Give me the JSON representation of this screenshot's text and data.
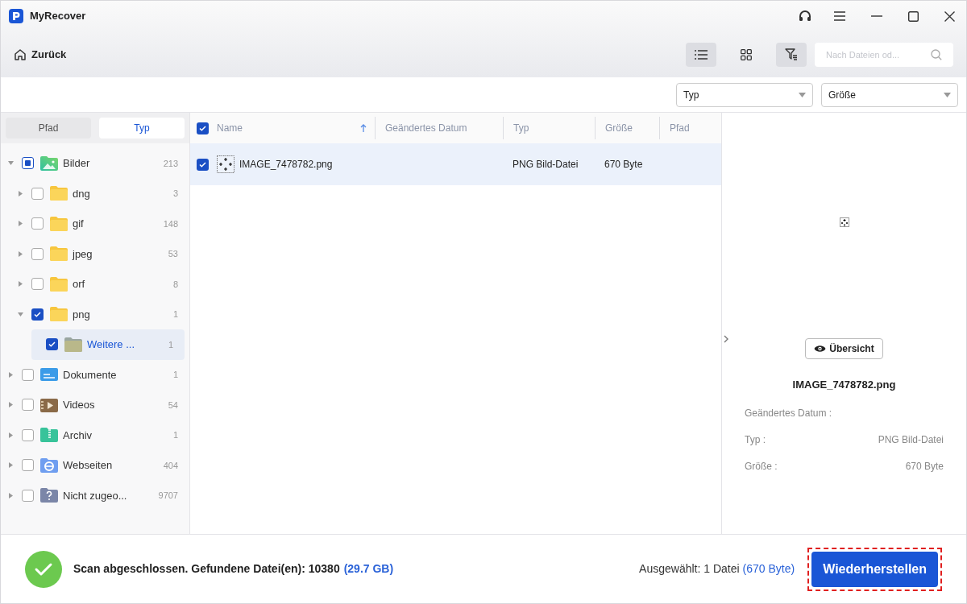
{
  "window": {
    "title": "MyRecover"
  },
  "toolbar": {
    "back": "Zurück",
    "views": [
      {
        "kind": "list",
        "selected": true
      },
      {
        "kind": "grid",
        "selected": false
      },
      {
        "kind": "filter",
        "selected": true
      }
    ],
    "search": {
      "placeholder": "Nach Dateien od..."
    }
  },
  "filters": [
    {
      "label": "Typ"
    },
    {
      "label": "Größe"
    }
  ],
  "sidebar": {
    "tabs": [
      {
        "label": "Pfad",
        "selected": false
      },
      {
        "label": "Typ",
        "selected": true
      }
    ],
    "items": [
      {
        "label": "Bilder",
        "count": "213",
        "kind": "images",
        "checked": false,
        "partial": true,
        "expanded": true,
        "selected": false,
        "children": [
          {
            "label": "dng",
            "count": "3",
            "kind": "folder",
            "checked": false,
            "expanded": false,
            "selected": false
          },
          {
            "label": "gif",
            "count": "148",
            "kind": "folder",
            "checked": false,
            "expanded": false,
            "selected": false
          },
          {
            "label": "jpeg",
            "count": "53",
            "kind": "folder",
            "checked": false,
            "expanded": false,
            "selected": false
          },
          {
            "label": "orf",
            "count": "8",
            "kind": "folder",
            "checked": false,
            "expanded": false,
            "selected": false
          },
          {
            "label": "png",
            "count": "1",
            "kind": "folder",
            "checked": true,
            "expanded": true,
            "selected": false,
            "children": [
              {
                "label": "Weitere ...",
                "count": "1",
                "kind": "subfolder",
                "checked": true,
                "selected": true
              }
            ]
          }
        ]
      },
      {
        "label": "Dokumente",
        "count": "1",
        "kind": "documents",
        "checked": false,
        "expanded": false,
        "selected": false
      },
      {
        "label": "Videos",
        "count": "54",
        "kind": "videos",
        "checked": false,
        "expanded": false,
        "selected": false
      },
      {
        "label": "Archiv",
        "count": "1",
        "kind": "archive",
        "checked": false,
        "expanded": false,
        "selected": false
      },
      {
        "label": "Webseiten",
        "count": "404",
        "kind": "web",
        "checked": false,
        "expanded": false,
        "selected": false
      },
      {
        "label": "Nicht zugeo...",
        "count": "9707",
        "kind": "unknown",
        "checked": false,
        "expanded": false,
        "selected": false
      }
    ]
  },
  "table": {
    "all_checked": true,
    "columns": [
      {
        "label": "Name",
        "sorted": true
      },
      {
        "label": "Geändertes Datum",
        "sorted": false
      },
      {
        "label": "Typ",
        "sorted": false
      },
      {
        "label": "Größe",
        "sorted": false
      },
      {
        "label": "Pfad",
        "sorted": false
      }
    ],
    "rows": [
      {
        "name": "IMAGE_7478782.png",
        "type": "PNG Bild-Datei",
        "size": "670 Byte",
        "checked": true,
        "selected": true
      }
    ]
  },
  "preview": {
    "button": "Übersicht",
    "filename": "IMAGE_7478782.png",
    "details": [
      {
        "label": "Geändertes Datum :"
      },
      {
        "label": "Typ :",
        "value": "PNG Bild-Datei"
      },
      {
        "label": "Größe :",
        "value": "670 Byte"
      }
    ]
  },
  "status_bar": {
    "message": "Scan abgeschlossen. Gefundene Datei(en): 10380",
    "total_size": "(29.7 GB)",
    "selection": "Ausgewählt: 1 Datei",
    "selection_size": "(670 Byte)",
    "recover_button": "Wiederherstellen"
  }
}
